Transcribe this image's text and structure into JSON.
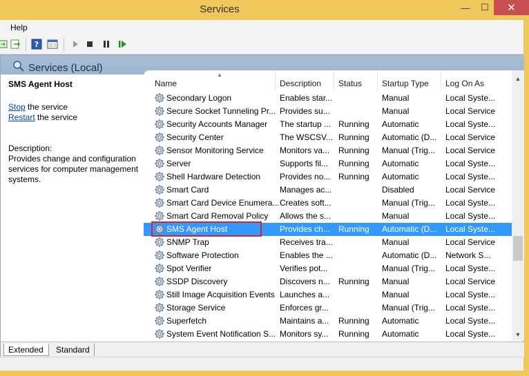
{
  "window": {
    "title": "Services",
    "minimize_glyph": "—",
    "maximize_glyph": "☐",
    "close_glyph": "✕"
  },
  "menu": {
    "help": "Help"
  },
  "header": {
    "title": "Services (Local)"
  },
  "left_pane": {
    "service_name": "SMS Agent Host",
    "stop_link": "Stop",
    "stop_rest": " the service",
    "restart_link": "Restart",
    "restart_rest": " the service",
    "description_label": "Description:",
    "description": "Provides change and configuration services for computer management systems."
  },
  "columns": {
    "name": "Name",
    "description": "Description",
    "status": "Status",
    "startup_type": "Startup Type",
    "log_on_as": "Log On As"
  },
  "rows": [
    {
      "name": "Secondary Logon",
      "description": "Enables star...",
      "status": "",
      "startup": "Manual",
      "logon": "Local Syste..."
    },
    {
      "name": "Secure Socket Tunneling Pr...",
      "description": "Provides su...",
      "status": "",
      "startup": "Manual",
      "logon": "Local Service"
    },
    {
      "name": "Security Accounts Manager",
      "description": "The startup ...",
      "status": "Running",
      "startup": "Automatic",
      "logon": "Local Syste..."
    },
    {
      "name": "Security Center",
      "description": "The WSCSV...",
      "status": "Running",
      "startup": "Automatic (D...",
      "logon": "Local Service"
    },
    {
      "name": "Sensor Monitoring Service",
      "description": "Monitors va...",
      "status": "Running",
      "startup": "Manual (Trig...",
      "logon": "Local Service"
    },
    {
      "name": "Server",
      "description": "Supports fil...",
      "status": "Running",
      "startup": "Automatic",
      "logon": "Local Syste..."
    },
    {
      "name": "Shell Hardware Detection",
      "description": "Provides no...",
      "status": "Running",
      "startup": "Automatic",
      "logon": "Local Syste..."
    },
    {
      "name": "Smart Card",
      "description": "Manages ac...",
      "status": "",
      "startup": "Disabled",
      "logon": "Local Service"
    },
    {
      "name": "Smart Card Device Enumera...",
      "description": "Creates soft...",
      "status": "",
      "startup": "Manual (Trig...",
      "logon": "Local Syste..."
    },
    {
      "name": "Smart Card Removal Policy",
      "description": "Allows the s...",
      "status": "",
      "startup": "Manual",
      "logon": "Local Syste..."
    },
    {
      "name": "SMS Agent Host",
      "description": "Provides ch...",
      "status": "Running",
      "startup": "Automatic (D...",
      "logon": "Local Syste..."
    },
    {
      "name": "SNMP Trap",
      "description": "Receives tra...",
      "status": "",
      "startup": "Manual",
      "logon": "Local Service"
    },
    {
      "name": "Software Protection",
      "description": "Enables the ...",
      "status": "",
      "startup": "Automatic (D...",
      "logon": "Network S..."
    },
    {
      "name": "Spot Verifier",
      "description": "Verifies pot...",
      "status": "",
      "startup": "Manual (Trig...",
      "logon": "Local Syste..."
    },
    {
      "name": "SSDP Discovery",
      "description": "Discovers n...",
      "status": "Running",
      "startup": "Manual",
      "logon": "Local Service"
    },
    {
      "name": "Still Image Acquisition Events",
      "description": "Launches a...",
      "status": "",
      "startup": "Manual",
      "logon": "Local Syste..."
    },
    {
      "name": "Storage Service",
      "description": "Enforces gr...",
      "status": "",
      "startup": "Manual (Trig...",
      "logon": "Local Syste..."
    },
    {
      "name": "Superfetch",
      "description": "Maintains a...",
      "status": "Running",
      "startup": "Automatic",
      "logon": "Local Syste..."
    },
    {
      "name": "System Event Notification S...",
      "description": "Monitors sy...",
      "status": "Running",
      "startup": "Automatic",
      "logon": "Local Syste..."
    }
  ],
  "selected_row_index": 10,
  "tabs": {
    "extended": "Extended",
    "standard": "Standard"
  },
  "colors": {
    "title_bar": "#f0c75a",
    "selection": "#3399ff",
    "highlight_box": "#e0202a",
    "close_button": "#c75050"
  }
}
